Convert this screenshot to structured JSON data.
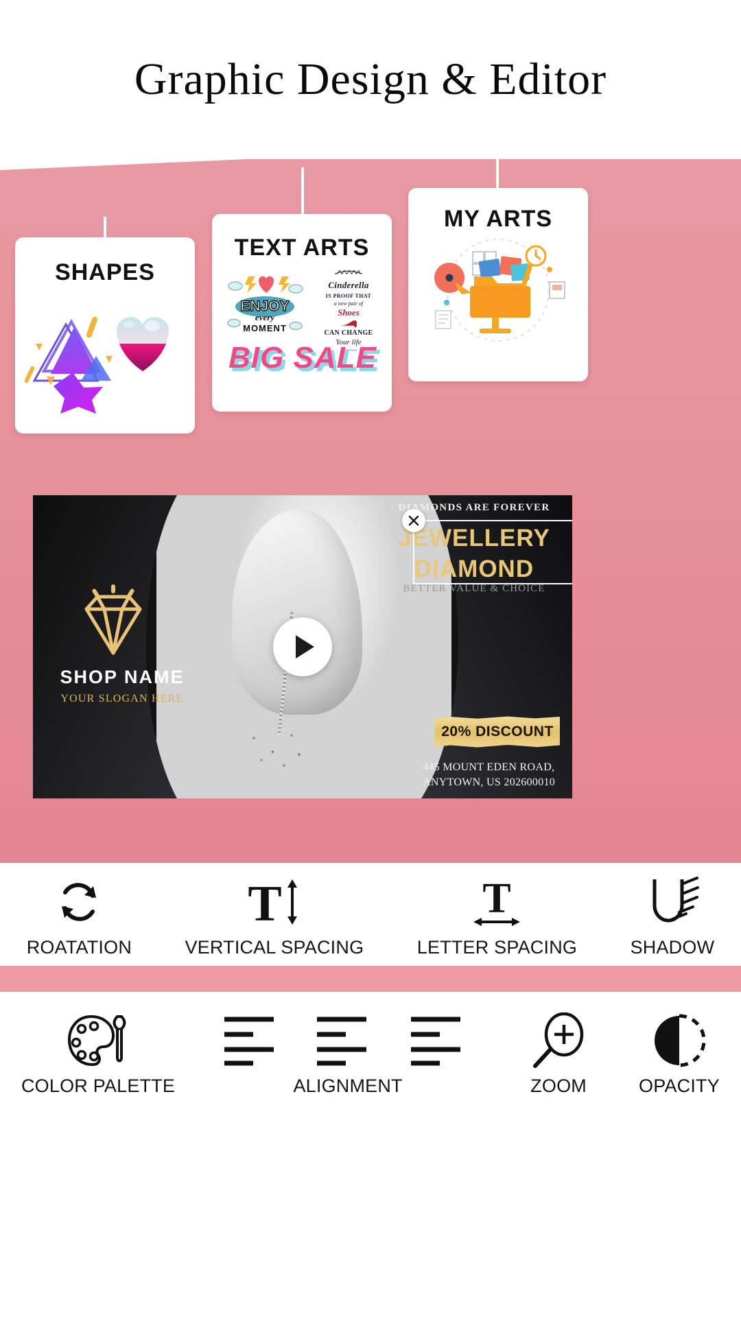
{
  "header": {
    "title": "Graphic Design & Editor"
  },
  "theme": {
    "pink": "#e8929c",
    "pink_divider": "#ef9aa4",
    "gold": "#e7c879",
    "card_white": "#ffffff",
    "ink": "#111111"
  },
  "categories": [
    {
      "id": "shapes",
      "title": "SHAPES",
      "icon": "shapes-icon"
    },
    {
      "id": "text-arts",
      "title": "TEXT ARTS",
      "icon": "text-arts-icon",
      "samples": {
        "enjoy": {
          "line1": "ENJOY",
          "line2": "every",
          "line3": "MOMENT"
        },
        "cinderella": {
          "line1": "Cinderella",
          "line2": "IS PROOF THAT",
          "line3": "a new pair of",
          "line4": "Shoes",
          "line5": "CAN CHANGE",
          "line6": "Your life",
          "line7": "modifyStore"
        },
        "big_sale": "BIG SALE"
      }
    },
    {
      "id": "my-arts",
      "title": "MY ARTS",
      "icon": "my-arts-folder-icon"
    }
  ],
  "canvas": {
    "ad": {
      "shop_name": "SHOP NAME",
      "shop_slogan": "YOUR SLOGAN HERE",
      "tagline_top": "DIAMONDS ARE FOREVER",
      "headline_line1": "JEWELLERY",
      "headline_line2": "DIAMOND",
      "tagline_sub": "BETTER VALUE & CHOICE",
      "discount": "20% DISCOUNT",
      "address_line1": "445 MOUNT EDEN ROAD,",
      "address_line2": "ANYTOWN, US 202600010",
      "logo_icon": "diamond-icon"
    },
    "controls": {
      "close_icon": "close-icon",
      "resize_icon": "resize-handle-icon",
      "play_icon": "play-icon"
    }
  },
  "toolbar_top": [
    {
      "label": "ROATATION",
      "icon": "rotation-icon"
    },
    {
      "label": "VERTICAL SPACING",
      "icon": "vertical-spacing-icon"
    },
    {
      "label": "LETTER SPACING",
      "icon": "letter-spacing-icon"
    },
    {
      "label": "SHADOW",
      "icon": "shadow-icon"
    }
  ],
  "toolbar_bottom": [
    {
      "label": "COLOR PALETTE",
      "icon": "color-palette-icon"
    },
    {
      "label": "ALIGNMENT",
      "icon": "alignment-icon"
    },
    {
      "label": "ZOOM",
      "icon": "zoom-in-icon"
    },
    {
      "label": "OPACITY",
      "icon": "opacity-icon"
    }
  ]
}
